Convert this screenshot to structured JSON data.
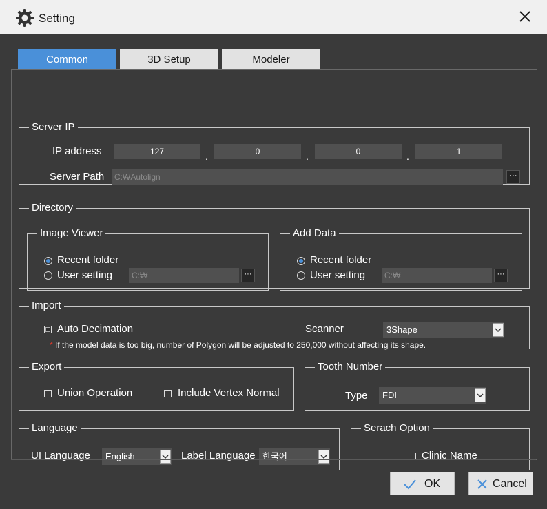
{
  "window": {
    "title": "Setting",
    "icon": "gear-icon",
    "close_icon": "close-icon"
  },
  "tabs": [
    {
      "label": "Common",
      "active": true
    },
    {
      "label": "3D Setup",
      "active": false
    },
    {
      "label": "Modeler",
      "active": false
    }
  ],
  "server_ip": {
    "legend": "Server IP",
    "ip_label": "IP address",
    "ip": [
      "127",
      "0",
      "0",
      "1"
    ],
    "separator": ".",
    "path_label": "Server Path",
    "path_value": "C:₩Autolign",
    "browse_label": "···"
  },
  "directory": {
    "legend": "Directory",
    "image_viewer": {
      "legend": "Image Viewer",
      "recent_label": "Recent folder",
      "user_label": "User setting",
      "path_value": "C:₩",
      "browse_label": "···",
      "selected": "recent"
    },
    "add_data": {
      "legend": "Add Data",
      "recent_label": "Recent folder",
      "user_label": "User setting",
      "path_value": "C:₩",
      "browse_label": "···",
      "selected": "recent"
    }
  },
  "import": {
    "legend": "Import",
    "auto_decimation_label": "Auto Decimation",
    "auto_decimation_checked": true,
    "scanner_label": "Scanner",
    "scanner_value": "3Shape",
    "note_star": "*",
    "note": "If the model data is too big, number of Polygon will be adjusted to 250,000 without affecting its shape."
  },
  "export": {
    "legend": "Export",
    "union_label": "Union Operation",
    "union_checked": false,
    "vertex_normal_label": "Include Vertex Normal",
    "vertex_normal_checked": false
  },
  "tooth_number": {
    "legend": "Tooth Number",
    "type_label": "Type",
    "type_value": "FDI"
  },
  "language": {
    "legend": "Language",
    "ui_label": "UI Language",
    "ui_value": "English",
    "label_label": "Label Language",
    "label_value": "한국어"
  },
  "search_option": {
    "legend": "Serach Option",
    "clinic_label": "Clinic Name",
    "clinic_checked": false
  },
  "buttons": {
    "ok": "OK",
    "cancel": "Cancel"
  },
  "colors": {
    "accent": "#4a90d9",
    "panel": "#3a3a3a",
    "field": "#505050",
    "note_star": "#e0392b"
  }
}
